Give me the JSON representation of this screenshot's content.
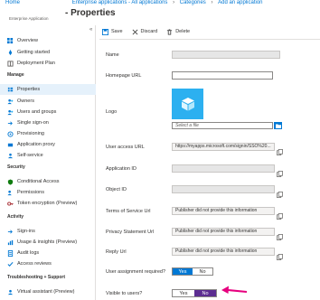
{
  "breadcrumb": {
    "items": [
      "Home",
      "Enterprise applications - All applications",
      "Categories",
      "Add an application"
    ]
  },
  "page": {
    "title": "- Properties",
    "subtitle": "Enterprise Application"
  },
  "toolbar": {
    "save": "Save",
    "discard": "Discard",
    "delete": "Delete"
  },
  "sidebar": {
    "collapse": "«",
    "top_items": [
      "Overview",
      "Getting started",
      "Deployment Plan"
    ],
    "manage_header": "Manage",
    "manage_items": [
      "Properties",
      "Owners",
      "Users and groups",
      "Single sign-on",
      "Provisioning",
      "Application proxy",
      "Self-service"
    ],
    "security_header": "Security",
    "security_items": [
      "Conditional Access",
      "Permissions",
      "Token encryption (Preview)"
    ],
    "activity_header": "Activity",
    "activity_items": [
      "Sign-ins",
      "Usage & insights (Preview)",
      "Audit logs",
      "Access reviews"
    ],
    "support_header": "Troubleshooting + Support",
    "support_items": [
      "Virtual assistant (Preview)"
    ]
  },
  "form": {
    "name_label": "Name",
    "homepage_label": "Homepage URL",
    "logo_label": "Logo",
    "file_placeholder": "Select a file",
    "user_access_label": "User access URL",
    "user_access_value": "https://myapps.microsoft.com/signin/SSO%20...",
    "application_id_label": "Application ID",
    "object_id_label": "Object ID",
    "tos_label": "Terms of Service Url",
    "tos_value": "Publisher did not provide this information",
    "privacy_label": "Privacy Statement Url",
    "privacy_value": "Publisher did not provide this information",
    "reply_label": "Reply Url",
    "reply_value": "Publisher did not provide this information",
    "assignment_label": "User assignment required?",
    "assignment_yes": "Yes",
    "assignment_no": "No",
    "visible_label": "Visible to users?",
    "visible_yes": "Yes",
    "visible_no": "No"
  },
  "colors": {
    "accent": "#0078d4",
    "selected_toggle": "#5c2d91",
    "arrow": "#e6007e",
    "logo_bg": "#2cb0f0"
  }
}
